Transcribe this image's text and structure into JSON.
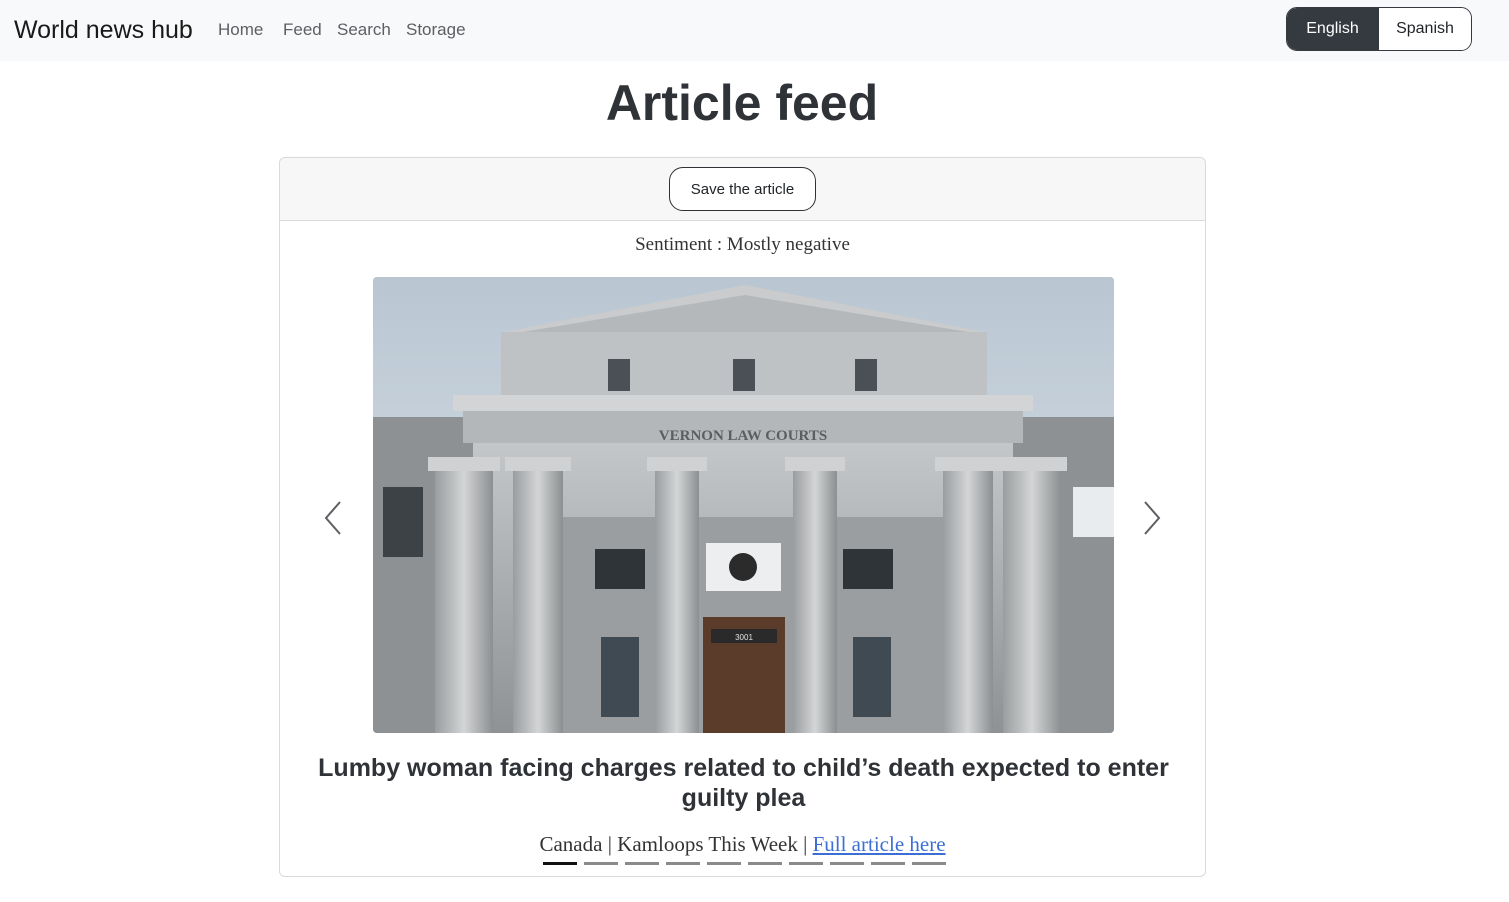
{
  "navbar": {
    "brand": "World news hub",
    "links": [
      "Home",
      "Feed",
      "Search",
      "Storage"
    ],
    "languages": {
      "english": "English",
      "spanish": "Spanish",
      "active": "English"
    }
  },
  "page": {
    "title": "Article feed"
  },
  "card": {
    "save_label": "Save the article",
    "sentiment": "Sentiment : Mostly negative",
    "image": {
      "sign_text": "VERNON LAW COURTS",
      "door_number": "3001"
    },
    "headline": "Lumby woman facing charges related to child’s death expected to enter guilty plea",
    "meta": {
      "country": "Canada",
      "separator": " | ",
      "source": "Kamloops This Week",
      "link_label": "Full article here"
    },
    "carousel": {
      "total": 10,
      "active_index": 0
    }
  },
  "colors": {
    "navbar_bg": "#f8f9fa",
    "active_lang_bg": "#343a40",
    "link": "#3b6fd6"
  },
  "icons": [
    "chevron-left-icon",
    "chevron-right-icon"
  ]
}
